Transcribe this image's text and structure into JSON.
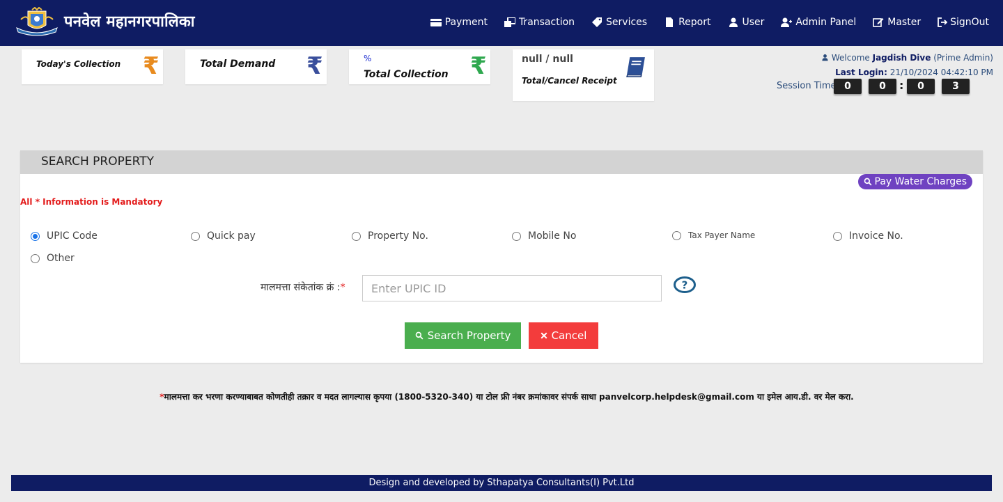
{
  "header": {
    "brand_name": "पनवेल महानगरपालिका",
    "nav": [
      {
        "label": "Payment",
        "icon": "credit-card-icon"
      },
      {
        "label": "Transaction",
        "icon": "windows-icon"
      },
      {
        "label": "Services",
        "icon": "tag-icon"
      },
      {
        "label": "Report",
        "icon": "file-icon"
      },
      {
        "label": "User",
        "icon": "user-icon"
      },
      {
        "label": "Admin Panel",
        "icon": "user-plus-icon"
      },
      {
        "label": "Master",
        "icon": "edit-icon"
      },
      {
        "label": "SignOut",
        "icon": "sign-out-icon"
      }
    ]
  },
  "stats": {
    "todays_collection": "Today's Collection",
    "total_demand": "Total Demand",
    "total_collection_pct": "%",
    "total_collection": "Total Collection",
    "receipt_counts": "null / null",
    "receipt_label": "Total/Cancel Receipt",
    "rupee_symbol": "₹"
  },
  "session": {
    "welcome_prefix": "Welcome",
    "user_name": "Jagdish Dive",
    "role": "(Prime Admin)",
    "last_login_label": "Last Login:",
    "last_login_value": "21/10/2024 04:42:10 PM",
    "session_time_label": "Session Time",
    "timer_digits": [
      "0",
      "0",
      "0",
      "3"
    ]
  },
  "search": {
    "title": "SEARCH PROPERTY",
    "pay_water_label": "Pay Water Charges",
    "mandatory_note": "All * Information is Mandatory",
    "options": [
      "UPIC Code",
      "Quick pay",
      "Property No.",
      "Mobile No",
      "Tax Payer Name",
      "Invoice No.",
      "Other"
    ],
    "selected_option": "UPIC Code",
    "field_label": "मालमत्ता संकेतांक क्रं :",
    "field_required": "*",
    "input_placeholder": "Enter UPIC ID",
    "input_value": "",
    "search_button": "Search Property",
    "cancel_button": "Cancel"
  },
  "helpline": {
    "star": "*",
    "text": "मालमत्ता कर भरणा करण्याबाबत कोणतीही तक्रार व मदत लागल्यास कृपया (1800-5320-340) या टोल फ्री नंबर क्रमांकावर संपर्क साधा panvelcorp.helpdesk@gmail.com या इमेल आय.डी. वर मेल करा."
  },
  "footer": {
    "text": "Design and developed by Sthapatya Consultants(I) Pvt.Ltd"
  },
  "colors": {
    "header_bg": "#0f1c63",
    "rupee_orange": "#e88b1f",
    "rupee_blue": "#3a4f9c",
    "rupee_green": "#2fa84f",
    "pay_water_purple": "#6f42c1",
    "search_green": "#4aae4e",
    "cancel_red": "#f33c3c",
    "mandatory_red": "#e31b1b"
  }
}
